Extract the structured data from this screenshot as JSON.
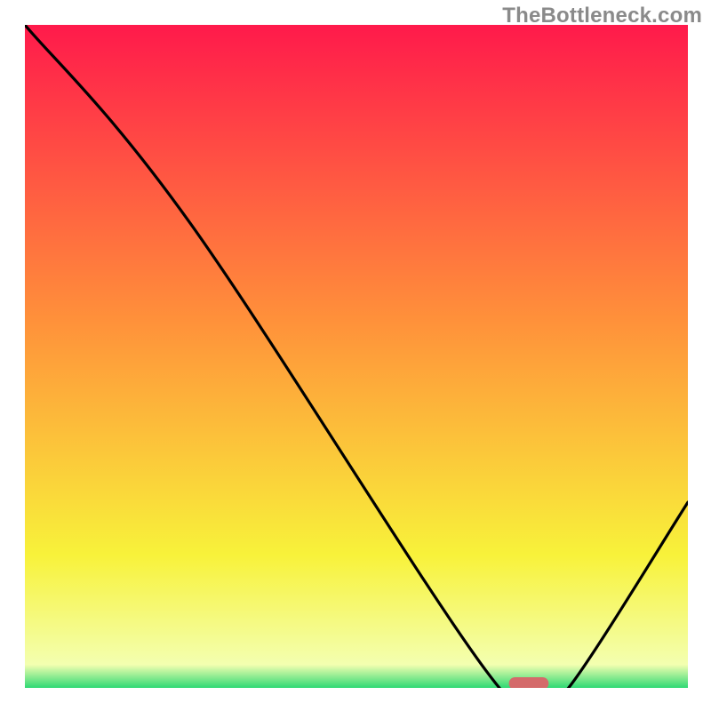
{
  "attribution": "TheBottleneck.com",
  "chart_data": {
    "type": "line",
    "title": "",
    "xlabel": "",
    "ylabel": "",
    "xlim": [
      0,
      100
    ],
    "ylim": [
      0,
      100
    ],
    "x": [
      0,
      25,
      70,
      78,
      82,
      100
    ],
    "values": [
      100,
      70,
      2,
      0,
      0,
      28
    ],
    "marker": {
      "x_start": 73,
      "x_end": 79,
      "y": 0
    },
    "background_gradient": [
      {
        "pos": 0.0,
        "color": "#ff1a4b"
      },
      {
        "pos": 0.45,
        "color": "#ff923a"
      },
      {
        "pos": 0.8,
        "color": "#f8f23a"
      },
      {
        "pos": 0.965,
        "color": "#f3ffb0"
      },
      {
        "pos": 1.0,
        "color": "#2fd974"
      }
    ],
    "curve_color": "#000000",
    "marker_color": "#d46a6a"
  }
}
